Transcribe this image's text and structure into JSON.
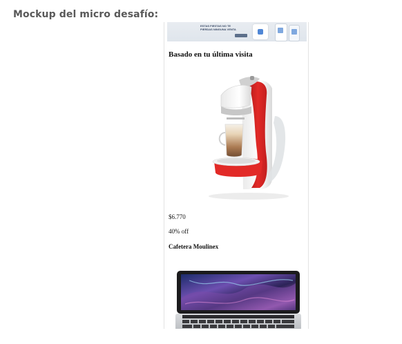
{
  "page": {
    "heading": "Mockup del micro desafío:"
  },
  "mockup": {
    "banner": {
      "text": "Estas fiestas no te pierdas ninguna venta"
    },
    "section_title": "Basado en tu última visita",
    "products": [
      {
        "image": "coffee-maker-image",
        "price": "$6.770",
        "discount": "40% off",
        "name": "Cafetera Moulinex"
      },
      {
        "image": "laptop-image"
      }
    ]
  },
  "colors": {
    "heading_text": "#595959",
    "coffee_maker_red": "#e22a27",
    "laptop_screen": "#3b2a6e"
  }
}
